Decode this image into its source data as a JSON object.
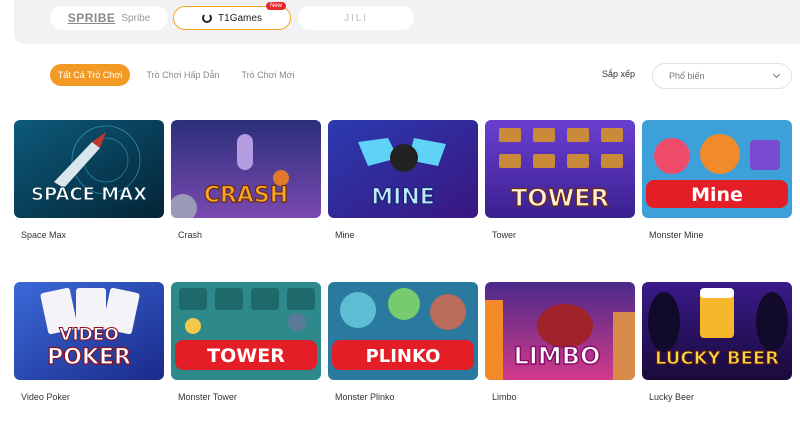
{
  "providers": [
    {
      "logo": "SPRIBE",
      "label": "Spribe",
      "selected": false
    },
    {
      "label": "T1Games",
      "badge": "New",
      "selected": true
    },
    {
      "label": "JILI",
      "selected": false
    }
  ],
  "tabs": [
    {
      "label": "Tất Cả Trò Chơi",
      "active": true
    },
    {
      "label": "Trò Chơi Hấp Dẫn",
      "active": false
    },
    {
      "label": "Trò Chơi Mới",
      "active": false
    }
  ],
  "sort": {
    "label": "Sắp xếp",
    "value": "Phổ biến"
  },
  "games": [
    {
      "name": "Space Max",
      "art_text": "SPACE MAX"
    },
    {
      "name": "Crash",
      "art_text": "CRASH"
    },
    {
      "name": "Mine",
      "art_text": "MINE"
    },
    {
      "name": "Tower",
      "art_text": "TOWER"
    },
    {
      "name": "Monster Mine",
      "art_text": "Mine"
    },
    {
      "name": "Video Poker",
      "art_text_1": "VIDEO",
      "art_text_2": "POKER"
    },
    {
      "name": "Monster Tower",
      "art_text": "TOWER"
    },
    {
      "name": "Monster Plinko",
      "art_text": "PLINKO"
    },
    {
      "name": "Limbo",
      "art_text": "LIMBO"
    },
    {
      "name": "Lucky Beer",
      "art_text": "LUCKY BEER"
    }
  ],
  "colors": {
    "accent": "#f39a24",
    "badge": "#e8252e",
    "banner_red": "#e41e26"
  }
}
